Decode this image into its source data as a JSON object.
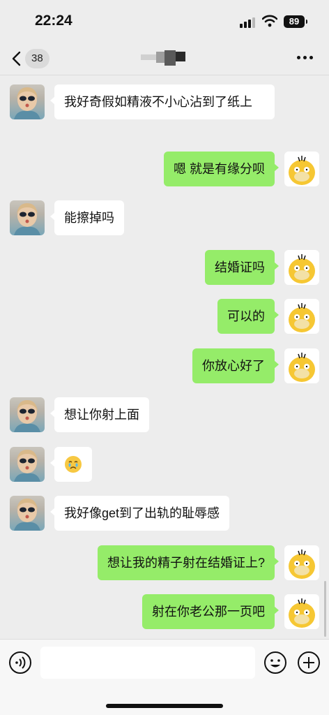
{
  "status_bar": {
    "time": "22:24",
    "battery": "89"
  },
  "nav": {
    "back_label": "back",
    "unread_count": "38"
  },
  "messages": [
    {
      "side": "in",
      "text": "我好奇假如精液不小心沾到了纸上"
    },
    {
      "side": "out",
      "text": "嗯 就是有缘分呗"
    },
    {
      "side": "in",
      "text": "能擦掉吗"
    },
    {
      "side": "out",
      "text": "结婚证吗"
    },
    {
      "side": "out",
      "text": "可以的"
    },
    {
      "side": "out",
      "text": "你放心好了"
    },
    {
      "side": "in",
      "text": "想让你射上面"
    },
    {
      "side": "in",
      "text": "😢",
      "kind": "emoji"
    },
    {
      "side": "in",
      "text": "我好像get到了出轨的耻辱感"
    },
    {
      "side": "out",
      "text": "想让我的精子射在结婚证上?"
    },
    {
      "side": "out",
      "text": "射在你老公那一页吧"
    }
  ],
  "icons": {
    "back": "chevron-left-icon",
    "more": "more-dots-icon",
    "voice": "voice-icon",
    "emoji": "emoji-icon",
    "plus": "plus-icon"
  },
  "colors": {
    "background": "#ededed",
    "outgoing_bubble": "#95ec69",
    "incoming_bubble": "#ffffff"
  }
}
